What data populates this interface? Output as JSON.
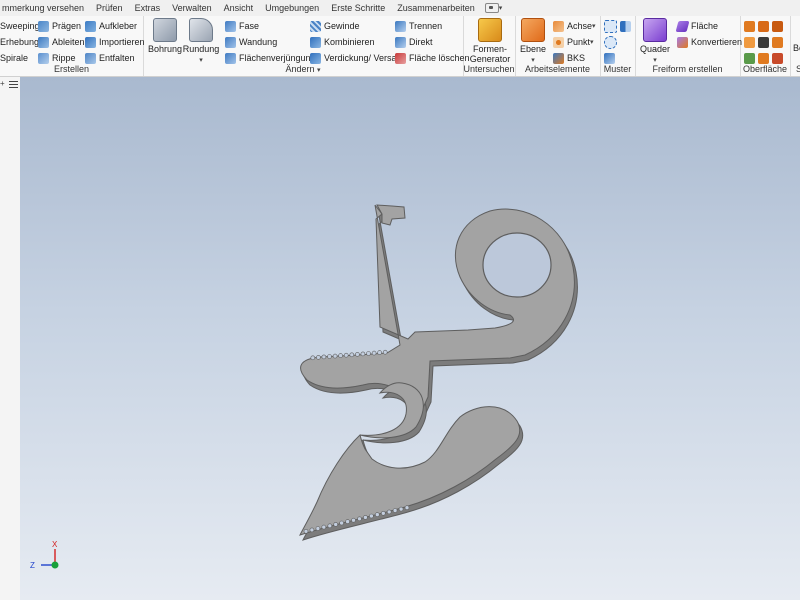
{
  "menu": {
    "items": [
      "mmerkung versehen",
      "Prüfen",
      "Extras",
      "Verwalten",
      "Ansicht",
      "Umgebungen",
      "Erste Schritte",
      "Zusammenarbeiten"
    ]
  },
  "erstellen": {
    "label": "Erstellen",
    "sweeping": "Sweeping",
    "praegen": "Prägen",
    "aufkleber": "Aufkleber",
    "erhebung": "Erhebung",
    "ableiten": "Ableiten",
    "importieren": "Importieren",
    "spirale": "Spirale",
    "rippe": "Rippe",
    "entfalten": "Entfalten"
  },
  "aendern": {
    "label": "Ändern",
    "bohrung": "Bohrung",
    "rundung": "Rundung",
    "fase": "Fase",
    "wandung": "Wandung",
    "flaechenverjuengung": "Flächenverjüngung",
    "gewinde": "Gewinde",
    "kombinieren": "Kombinieren",
    "verdickung": "Verdickung/ Versatz",
    "trennen": "Trennen",
    "direkt": "Direkt",
    "flaeche_loeschen": "Fläche löschen"
  },
  "untersuchen": {
    "label": "Untersuchen",
    "formen_generator_1": "Formen-",
    "formen_generator_2": "Generator"
  },
  "arbeitselemente": {
    "label": "Arbeitselemente",
    "ebene": "Ebene",
    "achse": "Achse",
    "punkt": "Punkt",
    "bks": "BKS"
  },
  "muster": {
    "label": "Muster"
  },
  "freiform": {
    "label": "Freiform erstellen",
    "quader": "Quader",
    "flaeche": "Fläche",
    "konvertieren": "Konvertieren"
  },
  "oberflaeche": {
    "label": "Oberfläche"
  },
  "extra_group": {
    "label_partial": "S",
    "btn_partial": "Be"
  },
  "triad": {
    "x": "X",
    "y": "Y",
    "z": "Z"
  },
  "colors": {
    "viewport_top": "#a9b9cf",
    "viewport_bottom": "#e6ebf2",
    "part_face": "#a3a3a3",
    "part_edge": "#5e5e5e",
    "part_side": "#7c7c7c",
    "axis_x": "#d42020",
    "axis_y": "#18a03a",
    "axis_z": "#2244cc"
  }
}
